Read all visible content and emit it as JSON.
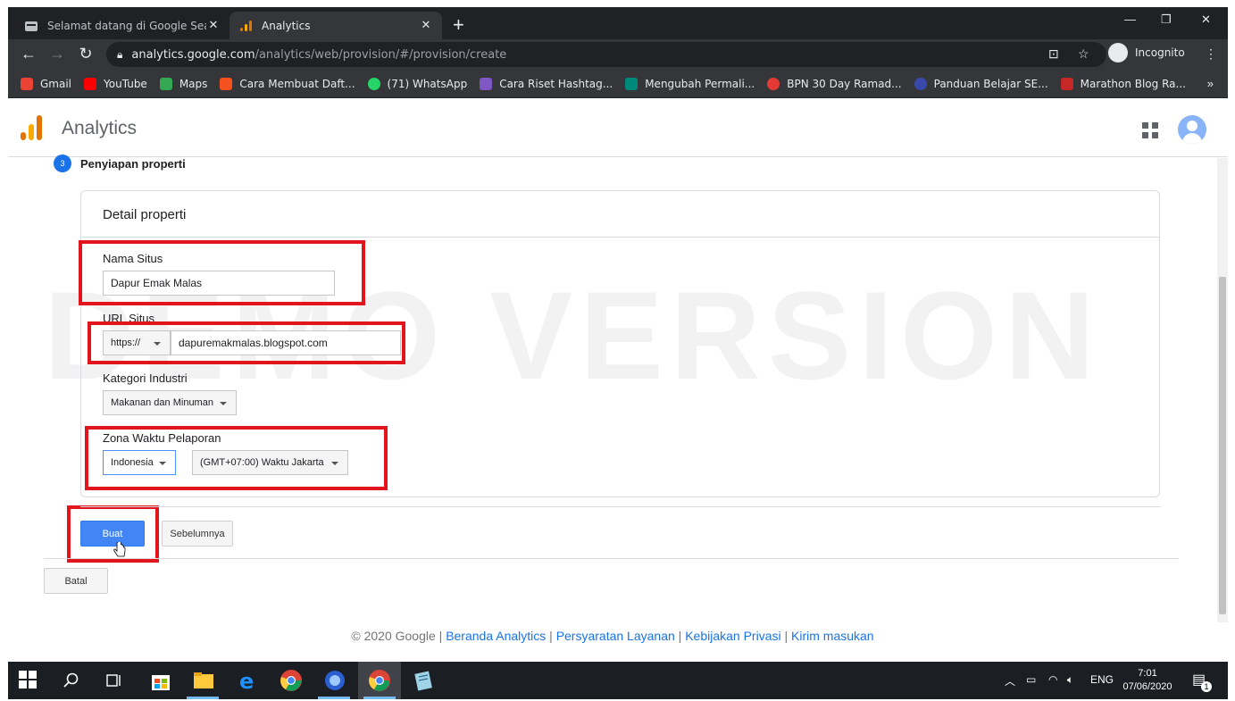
{
  "browser": {
    "tabs": [
      {
        "title": "Selamat datang di Google Search",
        "active": false
      },
      {
        "title": "Analytics",
        "active": true
      }
    ],
    "url_host": "analytics.google.com",
    "url_path": "/analytics/web/provision/#/provision/create",
    "incognito_label": "Incognito",
    "bookmarks": [
      {
        "label": "Gmail",
        "color": "#ea4335"
      },
      {
        "label": "YouTube",
        "color": "#ff0000"
      },
      {
        "label": "Maps",
        "color": "#34a853"
      },
      {
        "label": "Cara Membuat Daft...",
        "color": "#f4511e"
      },
      {
        "label": "(71) WhatsApp",
        "color": "#25d366"
      },
      {
        "label": "Cara Riset Hashtag...",
        "color": "#7e57c2"
      },
      {
        "label": "Mengubah Permali...",
        "color": "#00897b"
      },
      {
        "label": "BPN 30 Day Ramad...",
        "color": "#e53935"
      },
      {
        "label": "Panduan Belajar SE...",
        "color": "#3949ab"
      },
      {
        "label": "Marathon Blog Ra...",
        "color": "#c62828"
      }
    ]
  },
  "app": {
    "title": "Analytics"
  },
  "step": {
    "number": "3",
    "label": "Penyiapan properti"
  },
  "card": {
    "title": "Detail properti",
    "site_name_label": "Nama Situs",
    "site_name_value": "Dapur Emak Malas",
    "url_label": "URL Situs",
    "protocol_value": "https://",
    "url_value": "dapuremakmalas.blogspot.com",
    "category_label": "Kategori Industri",
    "category_value": "Makanan dan Minuman",
    "timezone_label": "Zona Waktu Pelaporan",
    "country_value": "Indonesia",
    "timezone_value": "(GMT+07:00) Waktu Jakarta"
  },
  "buttons": {
    "create": "Buat",
    "previous": "Sebelumnya",
    "cancel": "Batal"
  },
  "watermark": "DEMO VERSION",
  "footer": {
    "copyright": "© 2020 Google",
    "links": [
      "Beranda Analytics",
      "Persyaratan Layanan",
      "Kebijakan Privasi",
      "Kirim masukan"
    ]
  },
  "taskbar": {
    "language": "ENG",
    "time": "7:01",
    "date": "07/06/2020",
    "notification_count": "1"
  },
  "colors": {
    "accent": "#4285f4",
    "highlight_box": "#e3151c"
  }
}
